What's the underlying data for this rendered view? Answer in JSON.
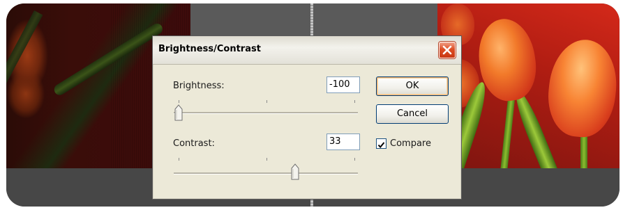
{
  "dialog": {
    "title": "Brightness/Contrast",
    "brightness": {
      "label": "Brightness:",
      "value": "-100",
      "slider_fraction": 0.0
    },
    "contrast": {
      "label": "Contrast:",
      "value": "33",
      "slider_fraction": 0.66
    },
    "buttons": {
      "ok": "OK",
      "cancel": "Cancel"
    },
    "compare": {
      "label": "Compare",
      "checked": true
    }
  },
  "colors": {
    "dialog_bg": "#ece9d8",
    "close_button": "#dd4d24",
    "input_border": "#7f9db9",
    "default_button_glow": "#f0b070"
  },
  "icons": [
    "close-icon",
    "checkmark-icon",
    "slider-thumb-icon"
  ]
}
